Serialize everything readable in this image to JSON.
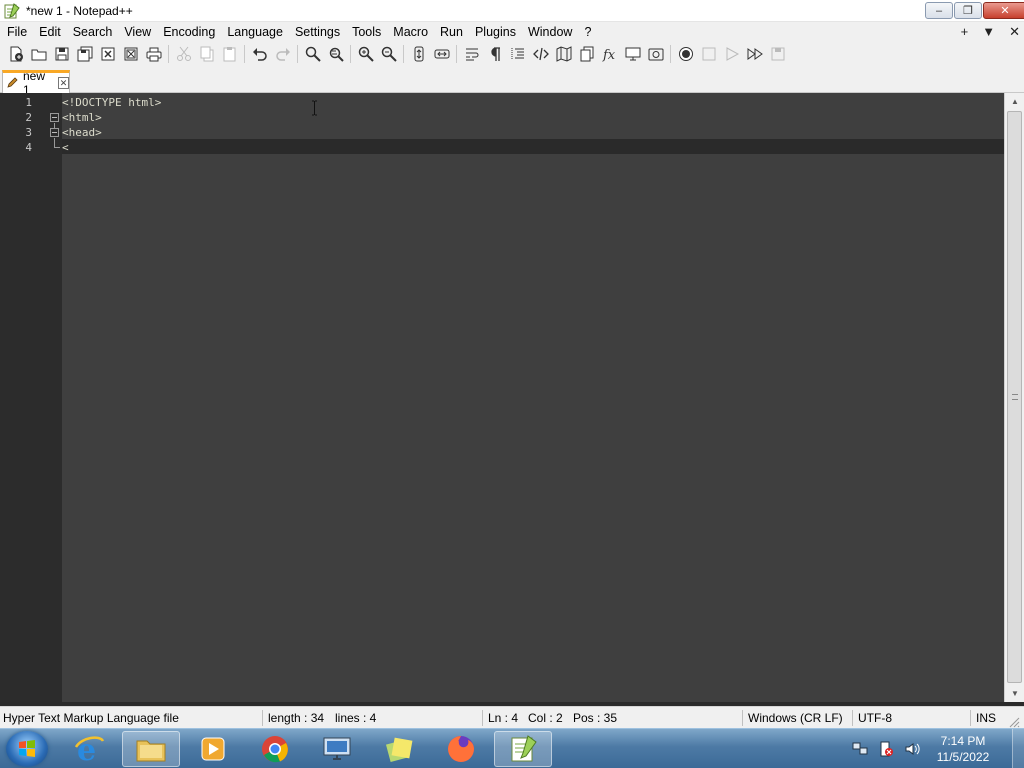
{
  "window": {
    "title": "*new 1 - Notepad++",
    "controls": {
      "minimize": "–",
      "maximize": "❐",
      "close": "✕"
    }
  },
  "menu": {
    "items": [
      "File",
      "Edit",
      "Search",
      "View",
      "Encoding",
      "Language",
      "Settings",
      "Tools",
      "Macro",
      "Run",
      "Plugins",
      "Window",
      "?"
    ],
    "right": {
      "add": "+",
      "dropdown": "▼",
      "close": "✕"
    }
  },
  "toolbar": {
    "icons": [
      "new-file-icon",
      "open-file-icon",
      "save-icon",
      "save-all-icon",
      "close-icon",
      "close-all-icon",
      "print-icon",
      "cut-icon",
      "copy-icon",
      "paste-icon",
      "undo-icon",
      "redo-icon",
      "find-icon",
      "replace-icon",
      "zoom-in-icon",
      "zoom-out-icon",
      "sync-vertical-icon",
      "sync-horizontal-icon",
      "word-wrap-icon",
      "show-all-chars-icon",
      "indent-guide-icon",
      "xml-tag-icon",
      "document-map-icon",
      "document-list-icon",
      "function-list-icon",
      "monitoring-icon",
      "folder-workspace-icon",
      "record-macro-icon",
      "stop-macro-icon",
      "play-macro-icon",
      "run-macro-multiple-icon",
      "save-macro-icon"
    ]
  },
  "tab": {
    "label": "new 1",
    "close": "✕"
  },
  "editor": {
    "lines": [
      {
        "num": "1",
        "text": "<!DOCTYPE html>"
      },
      {
        "num": "2",
        "text": "<html>"
      },
      {
        "num": "3",
        "text": "<head>"
      },
      {
        "num": "4",
        "text": "<"
      }
    ]
  },
  "scrollbar": {
    "up": "▲",
    "down": "▼"
  },
  "status": {
    "file_type": "Hyper Text Markup Language file",
    "length": "length : 34",
    "lines": "lines : 4",
    "ln": "Ln : 4",
    "col": "Col : 2",
    "pos": "Pos : 35",
    "eol": "Windows (CR LF)",
    "encoding": "UTF-8",
    "mode": "INS"
  },
  "taskbar": {
    "apps": [
      "internet-explorer-icon",
      "file-explorer-icon",
      "media-player-icon",
      "chrome-icon",
      "remote-desktop-icon",
      "sticky-notes-icon",
      "firefox-icon",
      "notepad-plus-plus-icon"
    ],
    "clock": {
      "time": "7:14 PM",
      "date": "11/5/2022"
    }
  },
  "colors": {
    "editor_bg": "#3f3f3f",
    "gutter_bg": "#2c2c2c",
    "current_line": "#2a2a2a",
    "code_text": "#dcdccc",
    "tab_accent": "#f9a825"
  }
}
